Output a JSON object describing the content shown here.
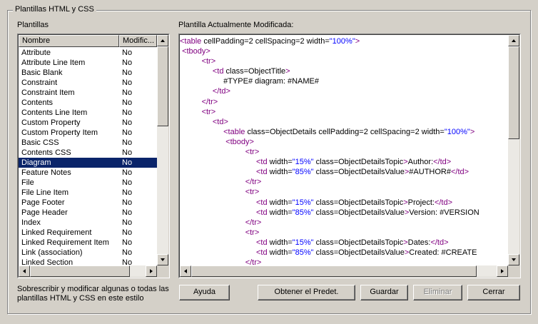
{
  "group": {
    "title": "Plantillas HTML y CSS"
  },
  "left": {
    "label": "Plantillas",
    "columns": [
      "Nombre",
      "Modific..."
    ],
    "rows": [
      [
        "Attribute",
        "No"
      ],
      [
        "Attribute Line Item",
        "No"
      ],
      [
        "Basic Blank",
        "No"
      ],
      [
        "Constraint",
        "No"
      ],
      [
        "Constraint Item",
        "No"
      ],
      [
        "Contents",
        "No"
      ],
      [
        "Contents Line Item",
        "No"
      ],
      [
        "Custom Property",
        "No"
      ],
      [
        "Custom Property Item",
        "No"
      ],
      [
        "Basic CSS",
        "No"
      ],
      [
        "Contents CSS",
        "No"
      ],
      [
        "Diagram",
        "No"
      ],
      [
        "Feature Notes",
        "No"
      ],
      [
        "File",
        "No"
      ],
      [
        "File Line Item",
        "No"
      ],
      [
        "Page Footer",
        "No"
      ],
      [
        "Page Header",
        "No"
      ],
      [
        "Index",
        "No"
      ],
      [
        "Linked Requirement",
        "No"
      ],
      [
        "Linked Requirement Item",
        "No"
      ],
      [
        "Link (association)",
        "No"
      ],
      [
        "Linked Section",
        "No"
      ]
    ],
    "selected_index": 11,
    "description": [
      "Sobrescribir y modificar algunas o todas las",
      "plantillas HTML y CSS en este estilo"
    ]
  },
  "right": {
    "label": "Plantilla Actualmente Modificada:",
    "code_lines": [
      "<table cellPadding=2 cellSpacing=2 width=\"100%\">",
      " <tbody>",
      "          <tr>",
      "               <td class=ObjectTitle>",
      "                    #TYPE# diagram: #NAME#",
      "               </td>",
      "          </tr>",
      "          <tr>",
      "               <td>",
      "                    <table class=ObjectDetails cellPadding=2 cellSpacing=2 width=\"100%\">",
      "                     <tbody>",
      "                              <tr>",
      "                                   <td width=\"15%\" class=ObjectDetailsTopic>Author:</td>",
      "                                   <td width=\"85%\" class=ObjectDetailsValue>#AUTHOR#</td>",
      "                              </tr>",
      "                              <tr>",
      "                                   <td width=\"15%\" class=ObjectDetailsTopic>Project:</td>",
      "                                   <td width=\"85%\" class=ObjectDetailsValue>Version: #VERSION",
      "                              </tr>",
      "                              <tr>",
      "                                   <td width=\"15%\" class=ObjectDetailsTopic>Dates:</td>",
      "                                   <td width=\"85%\" class=ObjectDetailsValue>Created: #CREATE",
      "                              </tr>"
    ]
  },
  "buttons": {
    "help": "Ayuda",
    "default": "Obtener el Predet.",
    "save": "Guardar",
    "delete": "Eliminar",
    "close": "Cerrar"
  },
  "colors": {
    "tag": "#800080",
    "string": "#0000ff",
    "selection": "#0a246a",
    "face": "#d4d0c8"
  }
}
